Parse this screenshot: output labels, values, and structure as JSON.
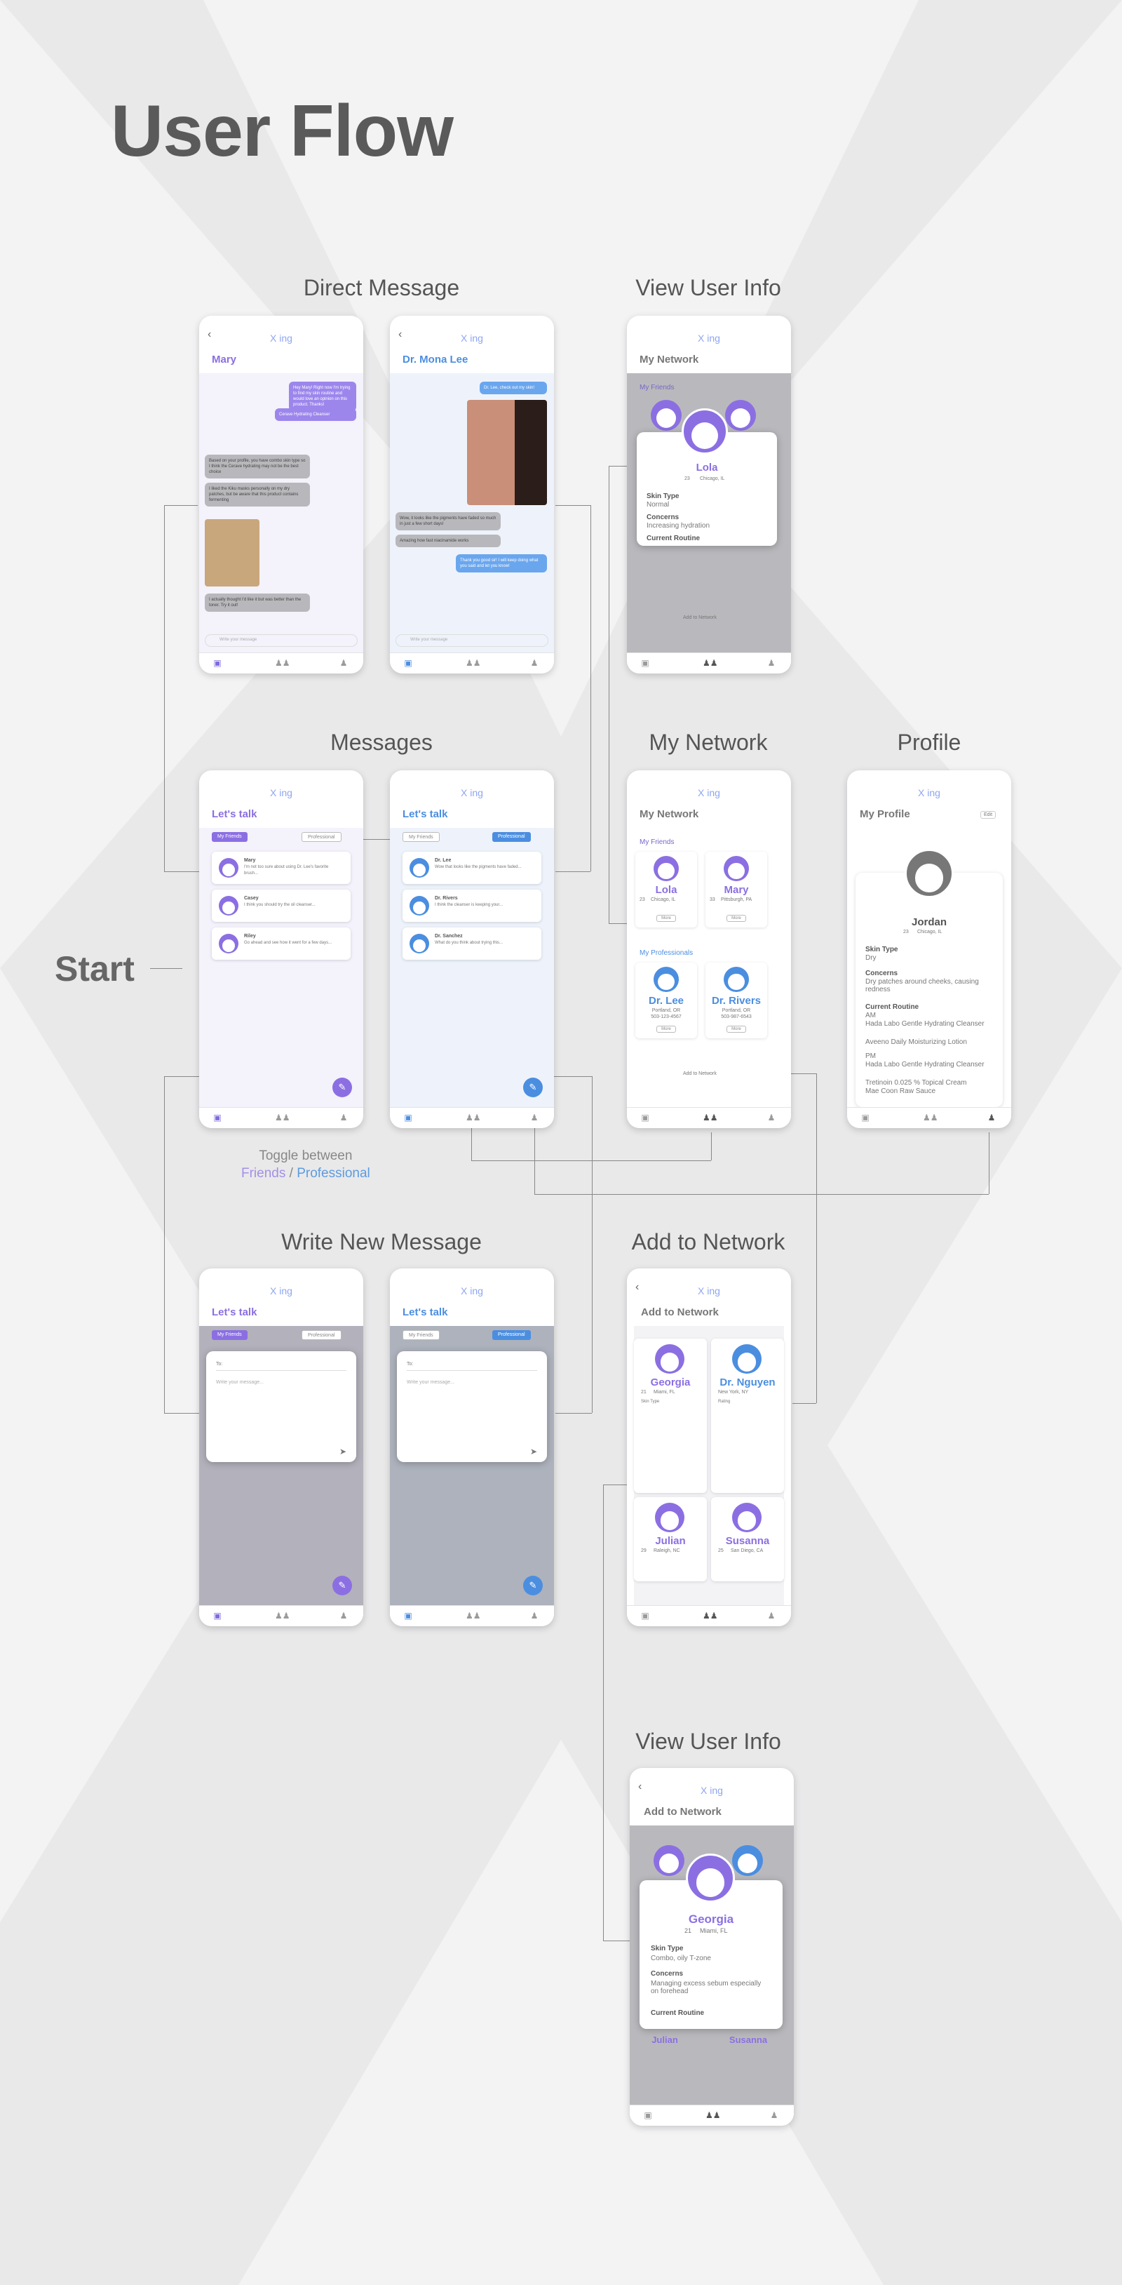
{
  "page_title": "User Flow",
  "start_label": "Start",
  "sections": {
    "direct_message": "Direct Message",
    "view_user_info": "View User Info",
    "messages": "Messages",
    "my_network": "My Network",
    "profile": "Profile",
    "write_new_message": "Write New Message",
    "add_to_network": "Add to Network",
    "view_user_info_2": "View User Info"
  },
  "toggle_note": {
    "line1": "Toggle between",
    "friends": "Friends",
    "slash": " / ",
    "professional": "Professional"
  },
  "app": {
    "logo": "X ing",
    "lets_talk": "Let's talk",
    "tab_friends": "My Friends",
    "tab_professional": "Professional",
    "input_placeholder": "Write your message",
    "my_network": "My Network",
    "my_friends": "My Friends",
    "my_professionals": "My Professionals",
    "add_to_network": "Add to Network",
    "more": "More",
    "my_profile": "My Profile",
    "edit": "Edit",
    "to": "To:",
    "write_placeholder": "Write your message..."
  },
  "dm_mary": {
    "name": "Mary",
    "messages": [
      {
        "side": "right",
        "text": "Hey Mary! Right now I'm trying to find my skin routine and would love an opinion on this product. Thanks!"
      },
      {
        "side": "right",
        "text": "Cerave Hydrating Cleanser"
      },
      {
        "side": "left",
        "text": "Based on your profile, you have combo skin type so I think the Cerave hydrating may not be the best choice"
      },
      {
        "side": "left",
        "text": "I liked the Kiku masks personally on my dry patches, but be aware that this product contains fermenting"
      },
      {
        "side": "left",
        "text": "I actually thought I'd like it but was better than the toner. Try it out!"
      }
    ]
  },
  "dm_lee": {
    "name": "Dr. Mona Lee",
    "messages": [
      {
        "side": "right",
        "text": "Dr. Lee, check out my skin!"
      },
      {
        "side": "left",
        "text": "Wow, it looks like the pigments have faded so much in just a few short days!"
      },
      {
        "side": "left",
        "text": "Amazing how fast niacinamide works"
      },
      {
        "side": "right",
        "text": "Thank you good sir! I will keep doing what you said and let you know!"
      }
    ]
  },
  "lola": {
    "name": "Lola",
    "age": "23",
    "location": "Chicago, IL",
    "skin_type_label": "Skin Type",
    "skin_type": "Normal",
    "concerns_label": "Concerns",
    "concerns": "Increasing hydration",
    "routine_label": "Current Routine"
  },
  "friend_chats": [
    {
      "name": "Mary",
      "preview": "I'm not too sure about using Dr. Lee's favorite brush..."
    },
    {
      "name": "Casey",
      "preview": "I think you should try the oil cleanser..."
    },
    {
      "name": "Riley",
      "preview": "Go ahead and see how it went for a few days..."
    }
  ],
  "pro_chats": [
    {
      "name": "Dr. Lee",
      "preview": "Wow that looks like the pigments have faded..."
    },
    {
      "name": "Dr. Rivers",
      "preview": "I think the cleanser is keeping your..."
    },
    {
      "name": "Dr. Sanchez",
      "preview": "What do you think about trying this..."
    }
  ],
  "network": {
    "friends": [
      {
        "name": "Lola",
        "age": "23",
        "loc": "Chicago, IL"
      },
      {
        "name": "Mary",
        "age": "33",
        "loc": "Pittsburgh, PA"
      }
    ],
    "pros": [
      {
        "name": "Dr. Lee",
        "loc": "Portland, OR",
        "phone": "503-123-4567"
      },
      {
        "name": "Dr. Rivers",
        "loc": "Portland, OR",
        "phone": "503-987-6543"
      }
    ]
  },
  "profile": {
    "name": "Jordan",
    "age": "23",
    "location": "Chicago, IL",
    "skin_type_label": "Skin Type",
    "skin_type": "Dry",
    "concerns_label": "Concerns",
    "concerns": "Dry patches around cheeks, causing redness",
    "routine_label": "Current Routine",
    "am": "AM",
    "am1": "Hada Labo Gentle Hydrating Cleanser",
    "am2": "Aveeno Daily Moisturizing Lotion",
    "pm": "PM",
    "pm1": "Hada Labo Gentle Hydrating Cleanser",
    "pm2": "Tretinoin 0.025 % Topical Cream",
    "pm3": "Mae Coon Raw Sauce"
  },
  "add_network": {
    "people": [
      {
        "name": "Georgia",
        "age": "21",
        "loc": "Miami, FL"
      },
      {
        "name": "Dr. Nguyen",
        "age": "",
        "loc": "New York, NY"
      },
      {
        "name": "Julian",
        "age": "29",
        "loc": "Raleigh, NC"
      },
      {
        "name": "Susanna",
        "age": "25",
        "loc": "San Diego, CA"
      }
    ],
    "skin_type": "Skin Type",
    "rating": "Rating"
  },
  "georgia": {
    "name": "Georgia",
    "age": "21",
    "location": "Miami, FL",
    "skin_type_label": "Skin Type",
    "skin_type": "Combo, oily T-zone",
    "concerns_label": "Concerns",
    "concerns": "Managing excess sebum especially on forehead",
    "routine_label": "Current Routine"
  }
}
